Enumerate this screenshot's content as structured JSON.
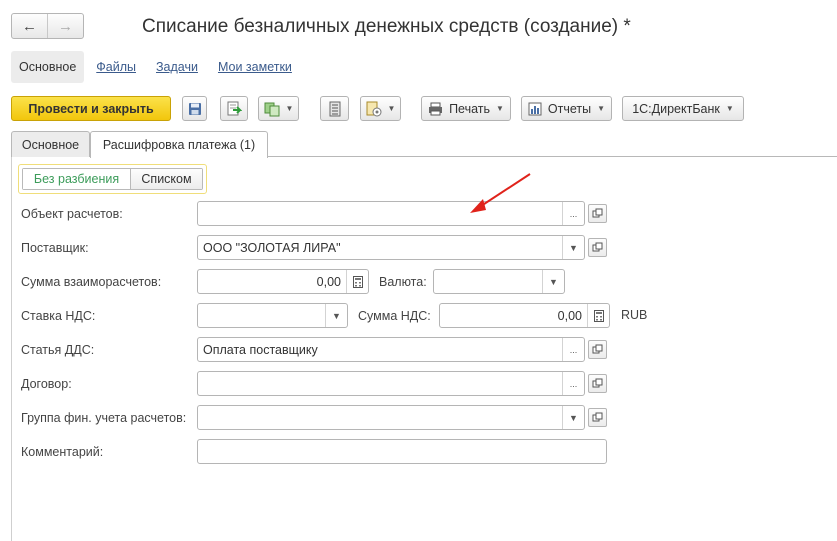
{
  "window": {
    "title": "Списание безналичных денежных средств (создание) *",
    "nav": {
      "back_icon": "arrow-left",
      "forward_icon": "arrow-right"
    }
  },
  "linkbar": {
    "items": [
      {
        "label": "Основное",
        "active": true
      },
      {
        "label": "Файлы"
      },
      {
        "label": "Задачи"
      },
      {
        "label": "Мои заметки"
      }
    ]
  },
  "toolbar": {
    "post_close": "Провести и закрыть",
    "print": "Печать",
    "reports": "Отчеты",
    "directbank": "1С:ДиректБанк",
    "icons": [
      "save-icon",
      "post-icon",
      "create-based-on-icon",
      "journal-icon",
      "document-settings-icon",
      "printer-icon",
      "reports-icon"
    ]
  },
  "tabs": [
    {
      "label": "Основное",
      "active": false
    },
    {
      "label": "Расшифровка платежа (1)",
      "active": true
    }
  ],
  "split_switch": {
    "options": [
      "Без разбиения",
      "Списком"
    ],
    "selected": "Без разбиения"
  },
  "form": {
    "settlement_object": {
      "label": "Объект расчетов:",
      "value": ""
    },
    "supplier": {
      "label": "Поставщик:",
      "value": "ООО \"ЗОЛОТАЯ ЛИРА\""
    },
    "settlement_amount": {
      "label": "Сумма взаиморасчетов:",
      "value": "0,00"
    },
    "currency": {
      "label": "Валюта:",
      "value": ""
    },
    "vat_rate": {
      "label": "Ставка НДС:",
      "value": ""
    },
    "vat_amount": {
      "label": "Сумма НДС:",
      "value": "0,00",
      "currency": "RUB"
    },
    "cashflow_item": {
      "label": "Статья ДДС:",
      "value": "Оплата поставщику"
    },
    "contract": {
      "label": "Договор:",
      "value": ""
    },
    "accounting_group": {
      "label": "Группа фин. учета расчетов:",
      "value": ""
    },
    "comment": {
      "label": "Комментарий:",
      "value": ""
    }
  },
  "annotation": {
    "color": "#e0231b"
  },
  "colors": {
    "primary_button": "#f5cc1b",
    "selected_switch_text": "#3c9c5a",
    "link": "#3b5b8c"
  }
}
